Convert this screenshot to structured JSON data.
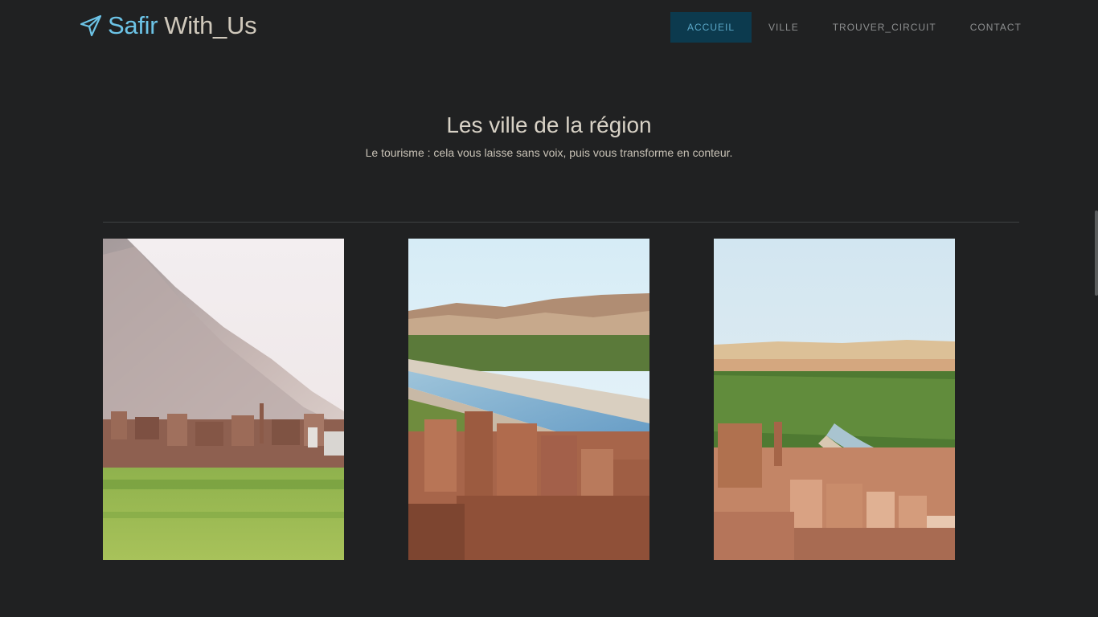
{
  "navbar": {
    "brand_first": "Safir",
    "brand_second": "With_Us",
    "items": [
      {
        "label": "ACCUEIL",
        "active": true
      },
      {
        "label": "VILLE",
        "active": false
      },
      {
        "label": "TROUVER_CIRCUIT",
        "active": false
      },
      {
        "label": "CONTACT",
        "active": false
      }
    ]
  },
  "section": {
    "title": "Les ville de la région",
    "subtitle": "Le tourisme : cela vous laisse sans voix, puis vous transforme en conteur."
  },
  "gallery": {
    "images": [
      {
        "icon": "city-mountain-photo"
      },
      {
        "icon": "kasbah-river-photo"
      },
      {
        "icon": "oasis-town-photo"
      }
    ]
  },
  "colors": {
    "background": "#202122",
    "accent": "#6cc3e6",
    "active_nav_bg": "#0c3a4e"
  }
}
